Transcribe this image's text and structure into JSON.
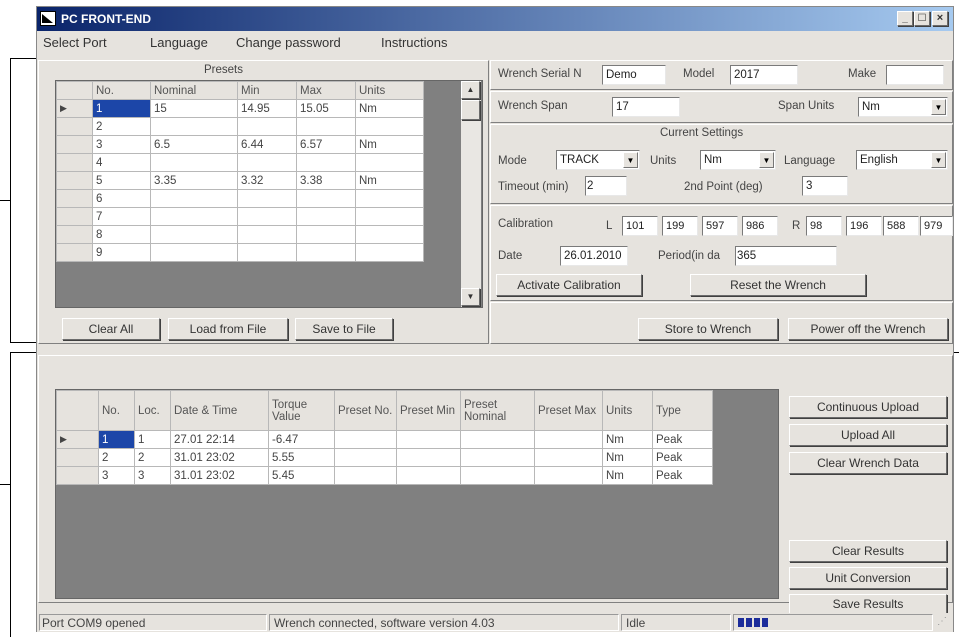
{
  "window": {
    "title": "PC FRONT-END"
  },
  "menu": [
    "Select Port",
    "Language",
    "Change password",
    "Instructions"
  ],
  "presets": {
    "title": "Presets",
    "columns": [
      "No.",
      "Nominal",
      "Min",
      "Max",
      "Units"
    ],
    "rows": [
      {
        "no": "1",
        "nominal": "15",
        "min": "14.95",
        "max": "15.05",
        "units": "Nm"
      },
      {
        "no": "2",
        "nominal": "",
        "min": "",
        "max": "",
        "units": ""
      },
      {
        "no": "3",
        "nominal": "6.5",
        "min": "6.44",
        "max": "6.57",
        "units": "Nm"
      },
      {
        "no": "4",
        "nominal": "",
        "min": "",
        "max": "",
        "units": ""
      },
      {
        "no": "5",
        "nominal": "3.35",
        "min": "3.32",
        "max": "3.38",
        "units": "Nm"
      },
      {
        "no": "6",
        "nominal": "",
        "min": "",
        "max": "",
        "units": ""
      },
      {
        "no": "7",
        "nominal": "",
        "min": "",
        "max": "",
        "units": ""
      },
      {
        "no": "8",
        "nominal": "",
        "min": "",
        "max": "",
        "units": ""
      },
      {
        "no": "9",
        "nominal": "",
        "min": "",
        "max": "",
        "units": ""
      }
    ],
    "buttons": {
      "clear_all": "Clear All",
      "load": "Load from File",
      "save": "Save to File"
    }
  },
  "wrench": {
    "serial_label": "Wrench Serial N",
    "serial": "Demo",
    "model_label": "Model",
    "model": "2017",
    "make_label": "Make",
    "make": "",
    "span_label": "Wrench Span",
    "span": "17",
    "span_units_label": "Span Units",
    "span_units": "Nm"
  },
  "current": {
    "title": "Current Settings",
    "mode_label": "Mode",
    "mode": "TRACK",
    "units_label": "Units",
    "units": "Nm",
    "language_label": "Language",
    "language": "English",
    "timeout_label": "Timeout (min)",
    "timeout": "2",
    "second_point_label": "2nd Point (deg)",
    "second_point": "3"
  },
  "calibration": {
    "label": "Calibration",
    "l_label": "L",
    "l": [
      "101",
      "199",
      "597",
      "986"
    ],
    "r_label": "R",
    "r": [
      "98",
      "196",
      "588",
      "979"
    ],
    "date_label": "Date",
    "date": "26.01.2010",
    "period_label": "Period(in da",
    "period": "365",
    "activate": "Activate Calibration",
    "reset": "Reset the Wrench"
  },
  "actions": {
    "store": "Store to Wrench",
    "power_off": "Power off the Wrench"
  },
  "results": {
    "columns": [
      "No.",
      "Loc.",
      "Date & Time",
      "Torque Value",
      "Preset No.",
      "Preset Min",
      "Preset Nominal",
      "Preset Max",
      "Units",
      "Type"
    ],
    "rows": [
      {
        "no": "1",
        "loc": "1",
        "dt": "27.01 22:14",
        "torque": "-6.47",
        "pno": "",
        "pmin": "",
        "pnom": "",
        "pmax": "",
        "units": "Nm",
        "type": "Peak"
      },
      {
        "no": "2",
        "loc": "2",
        "dt": "31.01 23:02",
        "torque": "5.55",
        "pno": "",
        "pmin": "",
        "pnom": "",
        "pmax": "",
        "units": "Nm",
        "type": "Peak"
      },
      {
        "no": "3",
        "loc": "3",
        "dt": "31.01 23:02",
        "torque": "5.45",
        "pno": "",
        "pmin": "",
        "pnom": "",
        "pmax": "",
        "units": "Nm",
        "type": "Peak"
      }
    ],
    "buttons": {
      "continuous": "Continuous Upload",
      "upload_all": "Upload All",
      "clear_wrench": "Clear Wrench Data",
      "clear_results": "Clear Results",
      "unit_conversion": "Unit Conversion",
      "save_results": "Save Results"
    }
  },
  "status": {
    "port": "Port COM9 opened",
    "connection": "Wrench connected, software version 4.03",
    "state": "Idle"
  },
  "colors": {
    "titlebar_start": "#0a246a",
    "titlebar_end": "#a6caf0",
    "face": "#e6e3de",
    "selection": "#1c46a8",
    "progress": "#1c2c9a"
  }
}
